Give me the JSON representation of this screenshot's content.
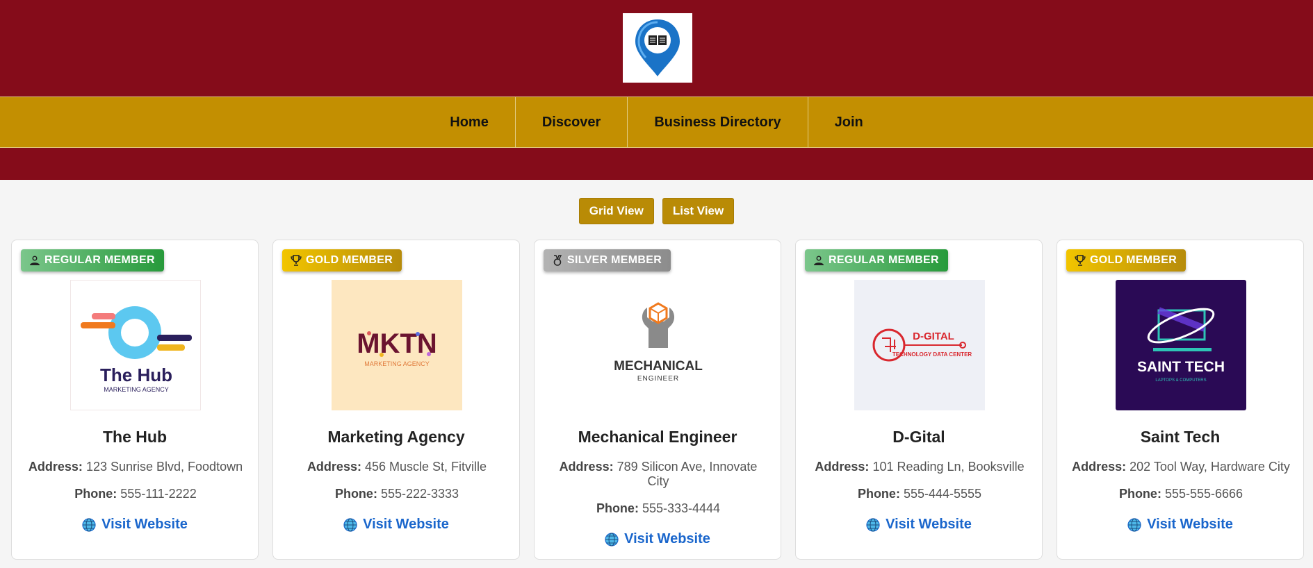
{
  "nav": {
    "items": [
      "Home",
      "Discover",
      "Business Directory",
      "Join"
    ]
  },
  "view_toggle": {
    "grid_label": "Grid View",
    "list_label": "List View"
  },
  "cards": [
    {
      "badge": "REGULAR MEMBER",
      "badge_type": "regular",
      "logo_text": "The Hub",
      "logo_subtext": "MARKETING AGENCY",
      "name": "The Hub",
      "address_label": "Address:",
      "address": "123 Sunrise Blvd, Foodtown",
      "phone_label": "Phone:",
      "phone": "555-111-2222",
      "link": "Visit Website"
    },
    {
      "badge": "GOLD MEMBER",
      "badge_type": "gold",
      "logo_text": "MKTN",
      "logo_subtext": "MARKETING AGENCY",
      "name": "Marketing Agency",
      "address_label": "Address:",
      "address": "456 Muscle St, Fitville",
      "phone_label": "Phone:",
      "phone": "555-222-3333",
      "link": "Visit Website"
    },
    {
      "badge": "SILVER MEMBER",
      "badge_type": "silver",
      "logo_text": "MECHANICAL",
      "logo_subtext": "ENGINEER",
      "name": "Mechanical Engineer",
      "address_label": "Address:",
      "address": "789 Silicon Ave, Innovate City",
      "phone_label": "Phone:",
      "phone": "555-333-4444",
      "link": "Visit Website"
    },
    {
      "badge": "REGULAR MEMBER",
      "badge_type": "regular",
      "logo_text": "D-GITAL",
      "logo_subtext": "TECHNOLOGY DATA CENTER",
      "name": "D-Gital",
      "address_label": "Address:",
      "address": "101 Reading Ln, Booksville",
      "phone_label": "Phone:",
      "phone": "555-444-5555",
      "link": "Visit Website"
    },
    {
      "badge": "GOLD MEMBER",
      "badge_type": "gold",
      "logo_text": "SAINT TECH",
      "logo_subtext": "LAPTOPS & COMPUTERS",
      "name": "Saint Tech",
      "address_label": "Address:",
      "address": "202 Tool Way, Hardware City",
      "phone_label": "Phone:",
      "phone": "555-555-6666",
      "link": "Visit Website"
    }
  ],
  "colors": {
    "header": "#850c1a",
    "nav": "#c38f01",
    "button": "#b98b06",
    "link": "#1a66cc"
  },
  "icons": {
    "logo": "map-pin-book-icon",
    "badge_regular": "person-icon",
    "badge_gold": "trophy-icon",
    "badge_silver": "medal-icon",
    "link": "globe-icon"
  }
}
